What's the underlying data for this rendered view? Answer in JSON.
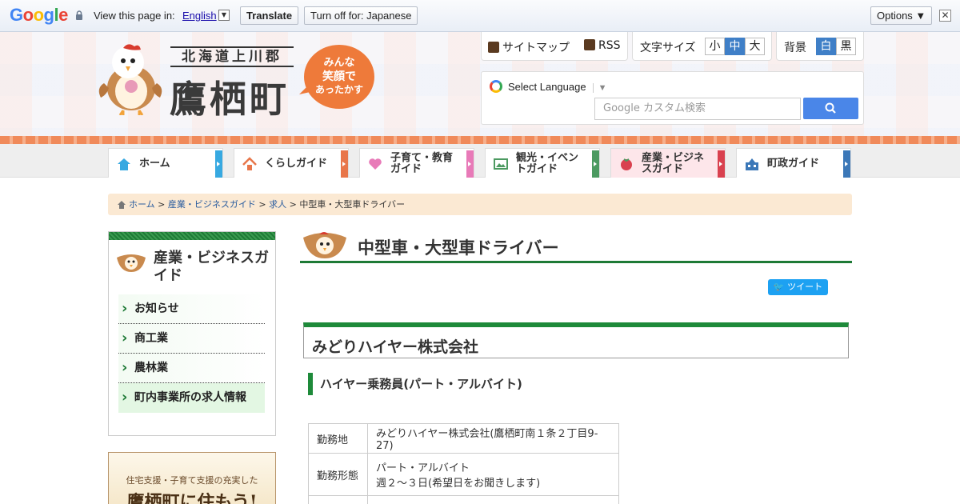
{
  "translate_bar": {
    "logo": [
      "G",
      "o",
      "o",
      "g",
      "l",
      "e"
    ],
    "view_label": "View this page in:",
    "language": "English",
    "arrow": "▼",
    "translate_btn": "Translate",
    "turnoff_btn": "Turn off for: Japanese",
    "options_btn": "Options ▼",
    "close": "✕"
  },
  "header": {
    "prefecture": "北海道上川郡",
    "town": "鷹栖町",
    "bubble": [
      "みんな",
      "笑顔で",
      "あったかす"
    ]
  },
  "tools": {
    "sitemap": "サイトマップ",
    "rss": "RSS",
    "font_size_label": "文字サイズ",
    "sizes": [
      "小",
      "中",
      "大"
    ],
    "bg_label": "背景",
    "bg_options": [
      "白",
      "黒"
    ],
    "select_language": "Select Language",
    "lang_arrow": "▼",
    "search_placeholder": "Google カスタム検索"
  },
  "nav": [
    {
      "label": "ホーム",
      "color": "#37a9e1"
    },
    {
      "label": "くらしガイド",
      "color": "#e8764a"
    },
    {
      "label": "子育て・教育ガイド",
      "line1": "子育て・教育",
      "line2": "ガイド",
      "color": "#e87ab8"
    },
    {
      "label": "観光・イベントガイド",
      "line1": "観光・イベン",
      "line2": "トガイド",
      "color": "#4c9a61"
    },
    {
      "label": "産業・ビジネスガイド",
      "line1": "産業・ビジネ",
      "line2": "スガイド",
      "color": "#d9414f"
    },
    {
      "label": "町政ガイド",
      "color": "#3c78b8"
    }
  ],
  "breadcrumb": {
    "home": "ホーム",
    "sep": ">",
    "industry": "産業・ビジネスガイド",
    "jobs": "求人",
    "current": "中型車・大型車ドライバー"
  },
  "sidebar": {
    "title": "産業・ビジネスガイド",
    "items": [
      "お知らせ",
      "商工業",
      "農林業",
      "町内事業所の求人情報"
    ],
    "banner_line1": "住宅支援・子育て支援の充実した",
    "banner_line2": "鷹栖町に住もう!"
  },
  "main": {
    "title": "中型車・大型車ドライバー",
    "tweet": "ツイート",
    "company": "みどりハイヤー株式会社",
    "job_title": "ハイヤー乗務員(パート・アルバイト)",
    "table": {
      "rows": [
        {
          "key": "勤務地",
          "value": "みどりハイヤー株式会社(鷹栖町南１条２丁目9-27)"
        },
        {
          "key": "勤務形態",
          "value_line1": "パート・アルバイト",
          "value_line2": "週２～３日(希望日をお聞きします)"
        }
      ]
    }
  }
}
